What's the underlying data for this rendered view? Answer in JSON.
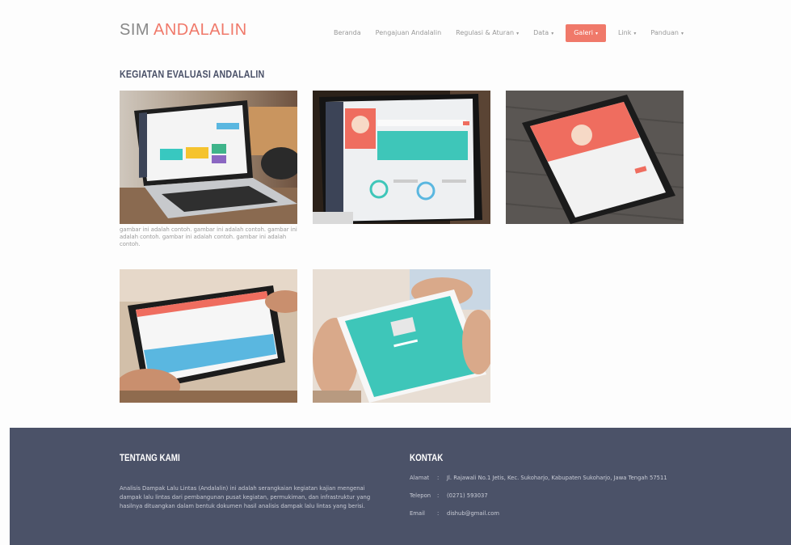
{
  "brand": {
    "part1": "SIM ",
    "part2": "ANDALALIN"
  },
  "nav": [
    {
      "label": "Beranda",
      "caret": false,
      "active": false
    },
    {
      "label": "Pengajuan Andalalin",
      "caret": false,
      "active": false
    },
    {
      "label": "Regulasi & Aturan",
      "caret": true,
      "active": false
    },
    {
      "label": "Data",
      "caret": true,
      "active": false
    },
    {
      "label": "Galeri",
      "caret": true,
      "active": true
    },
    {
      "label": "Link",
      "caret": true,
      "active": false
    },
    {
      "label": "Panduan",
      "caret": true,
      "active": false
    }
  ],
  "section": {
    "title": "KEGIATAN EVALUASI ANDALALIN",
    "caption": "gambar ini adalah contoh. gambar ini adalah contoh. gambar ini adalah contoh. gambar ini adalah contoh. gambar ini adalah contoh."
  },
  "footer": {
    "about_title": "TENTANG KAMI",
    "about_text": "Analisis Dampak Lalu Lintas (Andalalin) ini adalah serangkaian kegiatan kajian mengenai dampak lalu lintas dari pembangunan pusat kegiatan, permukiman, dan infrastruktur yang hasilnya dituangkan dalam bentuk dokumen hasil analisis dampak lalu lintas yang berisi.",
    "contact_title": "KONTAK",
    "contact": [
      {
        "label": "Alamat",
        "sep": ":",
        "value": "Jl. Rajawali No.1 Jetis, Kec. Sukoharjo, Kabupaten Sukoharjo, Jawa Tengah 57511"
      },
      {
        "label": "Telepon",
        "sep": ":",
        "value": "(0271) 593037"
      },
      {
        "label": "Email",
        "sep": ":",
        "value": "dishub@gmail.com"
      }
    ]
  },
  "colors": {
    "accent": "#f0796a",
    "footer_bg": "#4b5268"
  }
}
